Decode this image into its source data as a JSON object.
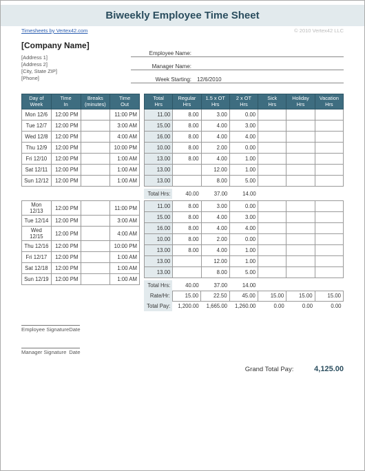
{
  "title": "Biweekly Employee Time Sheet",
  "link": "Timesheets by Vertex42.com",
  "copyright": "© 2010 Vertex42 LLC",
  "company": "[Company Name]",
  "address": [
    "[Address 1]",
    "[Address 2]",
    "[City, State  ZIP]",
    "[Phone]"
  ],
  "info": {
    "emp_lbl": "Employee Name:",
    "emp_val": "",
    "mgr_lbl": "Manager Name:",
    "mgr_val": "",
    "wk_lbl": "Week Starting:",
    "wk_val": "12/6/2010"
  },
  "time_cols": [
    "Day of Week",
    "Time In",
    "Breaks (minutes)",
    "Time Out"
  ],
  "tot_cols": [
    "Total Hrs",
    "Regular Hrs",
    "1.5 x OT Hrs",
    "2 x OT Hrs",
    "Sick Hrs",
    "Holiday Hrs",
    "Vacation Hrs"
  ],
  "week1": [
    {
      "d": "Mon 12/6",
      "in": "12:00 PM",
      "b": "",
      "out": "11:00 PM",
      "t": [
        "11.00",
        "8.00",
        "3.00",
        "0.00",
        "",
        "",
        ""
      ]
    },
    {
      "d": "Tue 12/7",
      "in": "12:00 PM",
      "b": "",
      "out": "3:00 AM",
      "t": [
        "15.00",
        "8.00",
        "4.00",
        "3.00",
        "",
        "",
        ""
      ]
    },
    {
      "d": "Wed 12/8",
      "in": "12:00 PM",
      "b": "",
      "out": "4:00 AM",
      "t": [
        "16.00",
        "8.00",
        "4.00",
        "4.00",
        "",
        "",
        ""
      ]
    },
    {
      "d": "Thu 12/9",
      "in": "12:00 PM",
      "b": "",
      "out": "10:00 PM",
      "t": [
        "10.00",
        "8.00",
        "2.00",
        "0.00",
        "",
        "",
        ""
      ]
    },
    {
      "d": "Fri 12/10",
      "in": "12:00 PM",
      "b": "",
      "out": "1:00 AM",
      "t": [
        "13.00",
        "8.00",
        "4.00",
        "1.00",
        "",
        "",
        ""
      ]
    },
    {
      "d": "Sat 12/11",
      "in": "12:00 PM",
      "b": "",
      "out": "1:00 AM",
      "t": [
        "13.00",
        "",
        "12.00",
        "1.00",
        "",
        "",
        ""
      ]
    },
    {
      "d": "Sun 12/12",
      "in": "12:00 PM",
      "b": "",
      "out": "1:00 AM",
      "t": [
        "13.00",
        "",
        "8.00",
        "5.00",
        "",
        "",
        ""
      ]
    }
  ],
  "week1_totals": {
    "lbl": "Total Hrs:",
    "v": [
      "40.00",
      "37.00",
      "14.00",
      "",
      "",
      ""
    ]
  },
  "week2": [
    {
      "d": "Mon 12/13",
      "in": "12:00 PM",
      "b": "",
      "out": "11:00 PM",
      "t": [
        "11.00",
        "8.00",
        "3.00",
        "0.00",
        "",
        "",
        ""
      ]
    },
    {
      "d": "Tue 12/14",
      "in": "12:00 PM",
      "b": "",
      "out": "3:00 AM",
      "t": [
        "15.00",
        "8.00",
        "4.00",
        "3.00",
        "",
        "",
        ""
      ]
    },
    {
      "d": "Wed 12/15",
      "in": "12:00 PM",
      "b": "",
      "out": "4:00 AM",
      "t": [
        "16.00",
        "8.00",
        "4.00",
        "4.00",
        "",
        "",
        ""
      ]
    },
    {
      "d": "Thu 12/16",
      "in": "12:00 PM",
      "b": "",
      "out": "10:00 PM",
      "t": [
        "10.00",
        "8.00",
        "2.00",
        "0.00",
        "",
        "",
        ""
      ]
    },
    {
      "d": "Fri 12/17",
      "in": "12:00 PM",
      "b": "",
      "out": "1:00 AM",
      "t": [
        "13.00",
        "8.00",
        "4.00",
        "1.00",
        "",
        "",
        ""
      ]
    },
    {
      "d": "Sat 12/18",
      "in": "12:00 PM",
      "b": "",
      "out": "1:00 AM",
      "t": [
        "13.00",
        "",
        "12.00",
        "1.00",
        "",
        "",
        ""
      ]
    },
    {
      "d": "Sun 12/19",
      "in": "12:00 PM",
      "b": "",
      "out": "1:00 AM",
      "t": [
        "13.00",
        "",
        "8.00",
        "5.00",
        "",
        "",
        ""
      ]
    }
  ],
  "week2_totals": {
    "lbl": "Total Hrs:",
    "v": [
      "40.00",
      "37.00",
      "14.00",
      "",
      "",
      ""
    ]
  },
  "rate": {
    "lbl": "Rate/Hr:",
    "v": [
      "15.00",
      "22.50",
      "45.00",
      "15.00",
      "15.00",
      "15.00"
    ]
  },
  "totalpay": {
    "lbl": "Total Pay:",
    "v": [
      "1,200.00",
      "1,665.00",
      "1,260.00",
      "0.00",
      "0.00",
      "0.00"
    ]
  },
  "sig": {
    "emp": "Employee Signature",
    "mgr": "Manager Signature",
    "date": "Date"
  },
  "grand": {
    "lbl": "Grand Total Pay:",
    "amt": "4,125.00"
  }
}
